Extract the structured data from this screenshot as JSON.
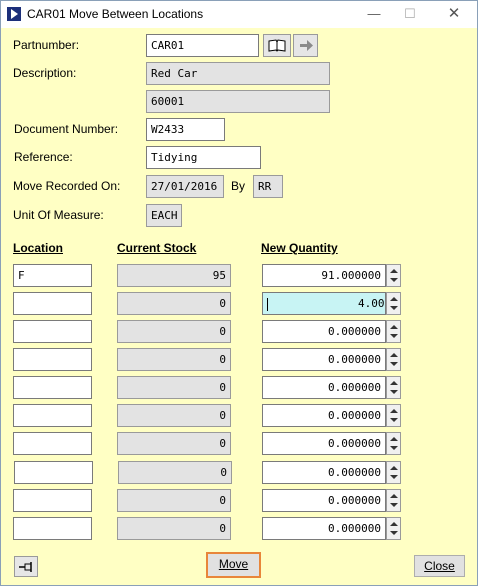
{
  "window": {
    "title": "CAR01 Move Between Locations",
    "minimize": "—",
    "maximize": "☐",
    "close": "✕"
  },
  "form": {
    "partnumber_label": "Partnumber:",
    "partnumber_value": "CAR01",
    "description_label": "Description:",
    "description_value": "Red Car",
    "description_value2": "60001",
    "document_number_label": "Document Number:",
    "document_number_value": "W2433",
    "reference_label": "Reference:",
    "reference_value": "Tidying",
    "move_recorded_label": "Move Recorded On:",
    "move_recorded_value": "27/01/2016",
    "by_label": "By",
    "by_value": "RR",
    "uom_label": "Unit Of Measure:",
    "uom_value": "EACH"
  },
  "grid": {
    "headers": {
      "location": "Location",
      "current_stock": "Current Stock",
      "new_quantity": "New Quantity"
    },
    "rows": [
      {
        "location": "F",
        "current_stock": "95",
        "new_quantity": "91.000000"
      },
      {
        "location": "",
        "current_stock": "0",
        "new_quantity": "4.000000"
      },
      {
        "location": "",
        "current_stock": "0",
        "new_quantity": "0.000000"
      },
      {
        "location": "",
        "current_stock": "0",
        "new_quantity": "0.000000"
      },
      {
        "location": "",
        "current_stock": "0",
        "new_quantity": "0.000000"
      },
      {
        "location": "",
        "current_stock": "0",
        "new_quantity": "0.000000"
      },
      {
        "location": "",
        "current_stock": "0",
        "new_quantity": "0.000000"
      },
      {
        "location": "",
        "current_stock": "0",
        "new_quantity": "0.000000"
      },
      {
        "location": "",
        "current_stock": "0",
        "new_quantity": "0.000000"
      },
      {
        "location": "",
        "current_stock": "0",
        "new_quantity": "0.000000"
      }
    ]
  },
  "buttons": {
    "move": "Move",
    "close": "Close"
  },
  "icons": {
    "book": "book-icon",
    "arrow": "arrow-right-icon",
    "pin": "pin-icon"
  },
  "colors": {
    "background": "#ffffc4",
    "active_field": "#c8f4f4",
    "focus_border": "#e8863a"
  }
}
